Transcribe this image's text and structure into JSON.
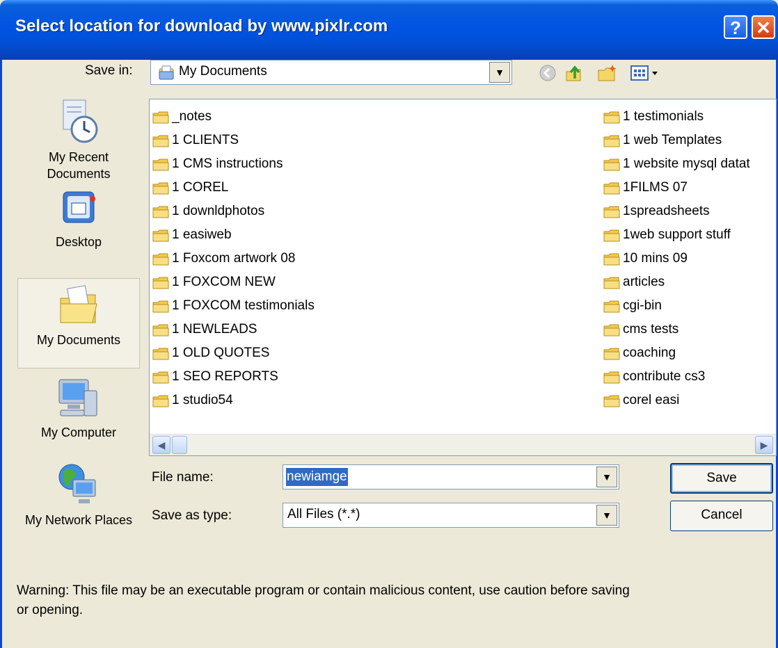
{
  "title": "Select location for download by www.pixlr.com",
  "save_in": {
    "label": "Save in:",
    "value": "My Documents"
  },
  "places": [
    {
      "label": "My Recent Documents"
    },
    {
      "label": "Desktop"
    },
    {
      "label": "My Documents"
    },
    {
      "label": "My Computer"
    },
    {
      "label": "My Network Places"
    }
  ],
  "files_col1": [
    "_notes",
    "1 CLIENTS",
    "1 CMS instructions",
    "1 COREL",
    "1 downldphotos",
    "1 easiweb",
    "1 Foxcom artwork 08",
    "1 FOXCOM NEW",
    "1 FOXCOM testimonials",
    "1 NEWLEADS",
    "1 OLD QUOTES",
    "1 SEO REPORTS",
    "1 studio54"
  ],
  "files_col2": [
    "1 testimonials",
    "1 web Templates",
    "1 website mysql datat",
    "1FILMS 07",
    "1spreadsheets",
    "1web support stuff",
    "10 mins 09",
    "articles",
    "cgi-bin",
    "cms tests",
    "coaching",
    "contribute cs3",
    "corel easi"
  ],
  "file_name": {
    "label": "File name:",
    "value": "newiamge"
  },
  "save_as_type": {
    "label": "Save as type:",
    "value": "All Files (*.*)"
  },
  "buttons": {
    "save": "Save",
    "cancel": "Cancel"
  },
  "warning": "Warning: This file may be an executable program or contain malicious content, use caution before saving or opening."
}
